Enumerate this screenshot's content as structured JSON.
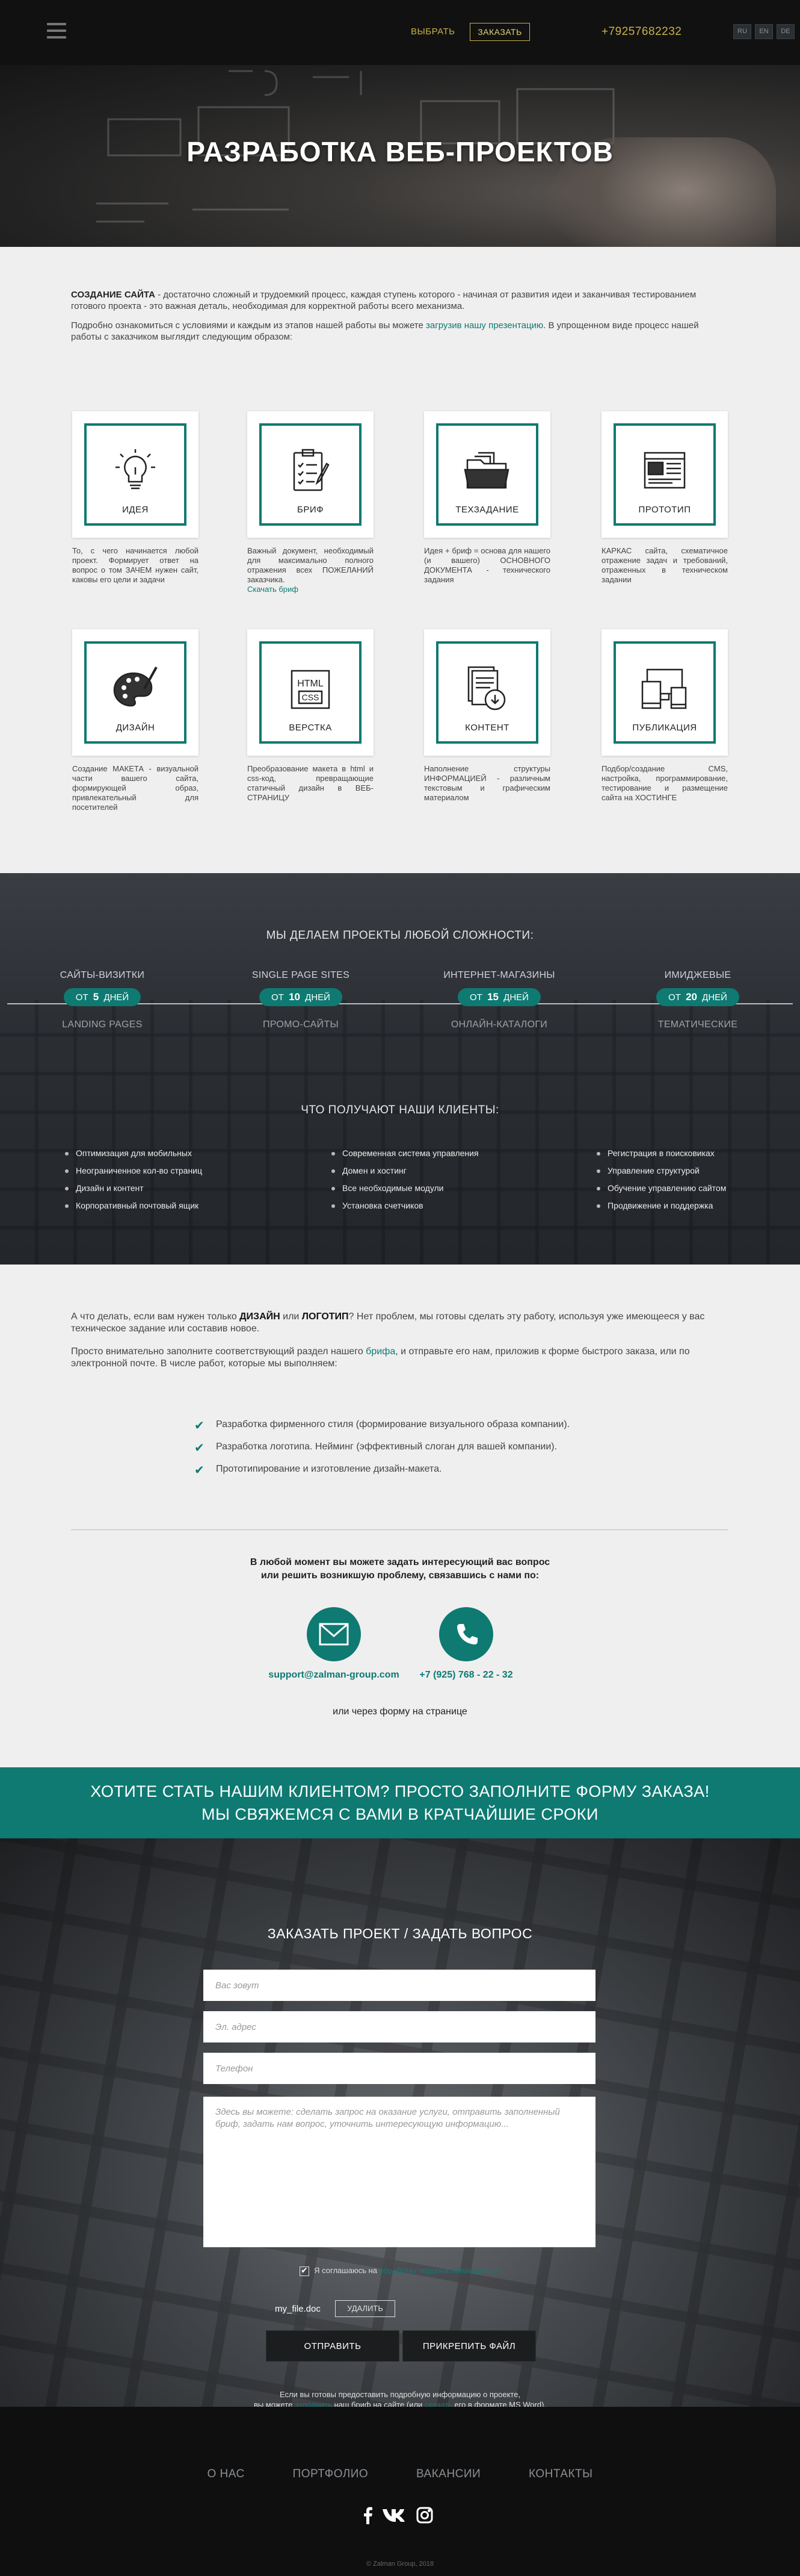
{
  "header": {
    "menu_icon": "hamburger-icon",
    "choose": "ВЫБРАТЬ",
    "order": "ЗАКАЗАТЬ",
    "phone": "+79257682232",
    "langs": [
      "RU",
      "EN",
      "DE"
    ]
  },
  "hero": {
    "title": "РАЗРАБОТКА ВЕБ-ПРОЕКТОВ"
  },
  "intro": {
    "lead_bold": "СОЗДАНИЕ САЙТА",
    "lead_text": " - достаточно сложный и трудоемкий процесс, каждая ступень которого  - начиная от развития идеи и заканчивая тестированием готового проекта - это важная деталь, необходимая для корректной работы всего механизма.",
    "second_pre": "Подробно ознакомиться с условиями и каждым из этапов нашей работы вы можете ",
    "second_link": "загрузив нашу презентацию",
    "second_post": ". В упрощенном виде процесс нашей работы с заказчиком выглядит следующим образом:"
  },
  "steps": [
    {
      "label": "ИДЕЯ",
      "icon": "lightbulb-icon",
      "desc": "То, с чего начинается любой проект. Формирует ответ на вопрос о том ЗАЧЕМ нужен сайт, каковы его цели и задачи",
      "link": ""
    },
    {
      "label": "БРИФ",
      "icon": "clipboard-icon",
      "desc": "Важный документ, необходимый для максимально полного отражения всех ПОЖЕЛАНИЙ заказчика.",
      "link": "Скачать бриф"
    },
    {
      "label": "ТЕХЗАДАНИЕ",
      "icon": "folder-icon",
      "desc": "Идея + бриф = основа для нашего (и вашего) ОСНОВНОГО ДОКУМЕНТА - технического задания",
      "link": ""
    },
    {
      "label": "ПРОТОТИП",
      "icon": "wireframe-icon",
      "desc": "КАРКАС сайта, схематичное отражение задач и требований, отраженных в техническом задании",
      "link": ""
    },
    {
      "label": "ДИЗАЙН",
      "icon": "palette-icon",
      "desc": "Создание МАКЕТА - визуальной части вашего сайта, формирующей образ, привлекательный для посетителей",
      "link": ""
    },
    {
      "label": "ВЕРСТКА",
      "icon": "html-css-icon",
      "desc": "Преобразование макета в html и css-код, превращающие статичный дизайн в ВЕБ-СТРАНИЦУ",
      "link": ""
    },
    {
      "label": "КОНТЕНТ",
      "icon": "document-download-icon",
      "desc": "Наполнение структуры ИНФОРМАЦИЕЙ - различным текстовым и графическим материалом",
      "link": ""
    },
    {
      "label": "ПУБЛИКАЦИЯ",
      "icon": "devices-icon",
      "desc": "Подбор/создание CMS, настройка, программирование, тестирование и размещение сайта на ХОСТИНГЕ",
      "link": ""
    }
  ],
  "projects": {
    "title": "МЫ ДЕЛАЕМ ПРОЕКТЫ ЛЮБОЙ СЛОЖНОСТИ:",
    "columns": [
      {
        "top": "САЙТЫ-ВИЗИТКИ",
        "from": "ОТ",
        "days": "5",
        "unit": "ДНЕЙ",
        "bottom": "LANDING PAGES"
      },
      {
        "top": "SINGLE PAGE SITES",
        "from": "ОТ",
        "days": "10",
        "unit": "ДНЕЙ",
        "bottom": "ПРОМО-САЙТЫ"
      },
      {
        "top": "ИНТЕРНЕТ-МАГАЗИНЫ",
        "from": "ОТ",
        "days": "15",
        "unit": "ДНЕЙ",
        "bottom": "ОНЛАЙН-КАТАЛОГИ"
      },
      {
        "top": "ИМИДЖЕВЫЕ",
        "from": "ОТ",
        "days": "20",
        "unit": "ДНЕЙ",
        "bottom": "ТЕМАТИЧЕСКИЕ"
      }
    ]
  },
  "clients": {
    "title": "ЧТО ПОЛУЧАЮТ НАШИ КЛИЕНТЫ:",
    "col1": [
      "Оптимизация для мобильных",
      "Неограниченное кол-во страниц",
      "Дизайн и контент",
      "Корпоративный почтовый ящик"
    ],
    "col2": [
      "Современная система управления",
      "Домен и хостинг",
      "Все необходимые модули",
      "Установка счетчиков"
    ],
    "col3": [
      "Регистрация в поисковиках",
      "Управление структурой",
      "Обучение управлению сайтом",
      "Продвижение и поддержка"
    ]
  },
  "design": {
    "p1_pre": "А что делать, если вам нужен только ",
    "p1_b1": "ДИЗАЙН",
    "p1_mid": " или ",
    "p1_b2": "ЛОГОТИП",
    "p1_post": "? Нет проблем, мы готовы сделать эту работу, используя уже имеющееся у вас техническое задание или составив новое.",
    "p2_pre": "Просто внимательно заполните соответствующий раздел нашего ",
    "p2_link": "брифа",
    "p2_post": ", и отправьте его нам, приложив к форме быстрого заказа, или по электронной почте. В числе работ, которые мы выполняем:",
    "checks": [
      "Разработка фирменного стиля (формирование визуального образа компании).",
      "Разработка логотипа. Нейминг (эффективный слоган для вашей компании).",
      "Прототипирование и изготовление дизайн-макета."
    ]
  },
  "contact": {
    "question_l1": "В любой момент вы можете задать интересующий вас вопрос",
    "question_l2": "или решить возникшую проблему, связавшись с нами по:",
    "email": "support@zalman-group.com",
    "phone": "+7 (925) 768 - 22 - 32",
    "or_form": "или через форму на странице"
  },
  "banner": {
    "line1": "ХОТИТЕ СТАТЬ НАШИМ КЛИЕНТОМ?  ПРОСТО ЗАПОЛНИТЕ ФОРМУ ЗАКАЗА!",
    "line2": "МЫ СВЯЖЕМСЯ С ВАМИ В КРАТЧАЙШИЕ СРОКИ"
  },
  "form": {
    "title": "ЗАКАЗАТЬ ПРОЕКТ / ЗАДАТЬ ВОПРОС",
    "name_placeholder": "Вас зовут",
    "email_placeholder": "Эл. адрес",
    "phone_placeholder": "Телефон",
    "message_placeholder": "Здесь вы можете: сделать запрос на оказание услуги, отправить заполненный бриф, задать нам вопрос, уточнить интересующую информацию...",
    "agree_pre": "Я соглашаюсь на ",
    "agree_link": "обработку персональных данных",
    "filename": "my_file.doc",
    "delete": "УДАЛИТЬ",
    "send": "ОТПРАВИТЬ",
    "attach": "ПРИКРЕПИТЬ ФАЙЛ",
    "note_l1": "Если вы готовы предоставить подробную информацию о проекте,",
    "note_pre": "вы можете ",
    "note_link1": "заполнить",
    "note_mid": " наш бриф на сайте (или ",
    "note_link2": "скачать",
    "note_post": " его в формате MS Word)."
  },
  "footer": {
    "nav": [
      "О НАС",
      "ПОРТФОЛИО",
      "ВАКАНСИИ",
      "КОНТАКТЫ"
    ],
    "copyright": "© Zalman Group, 2018"
  },
  "colors": {
    "accent": "#0e7a72",
    "gold": "#c8b24a",
    "dark": "#111111"
  }
}
